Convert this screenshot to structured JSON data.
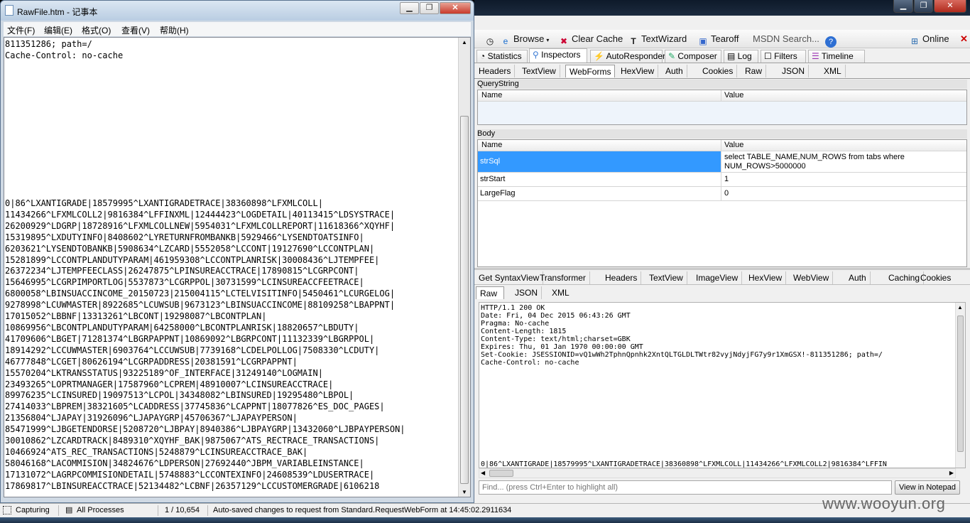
{
  "notepad": {
    "title": "RawFile.htm - 记事本",
    "menu": [
      "文件(F)",
      "编辑(E)",
      "格式(O)",
      "查看(V)",
      "帮助(H)"
    ],
    "content_top": "811351286; path=/\nCache-Control: no-cache",
    "content_body": "0|86^LXANTIGRADE|18579995^LXANTIGRADETRACE|38360898^LFXMLCOLL|\n11434266^LFXMLCOLL2|9816384^LFFINXML|12444423^LOGDETAIL|40113415^LDSYSTRACE|\n26200929^LDGRP|18728916^LFXMLCOLLNEW|5954031^LFXMLCOLLREPORT|11618366^XQYHF|\n15319895^LXDUTYINFO|8408602^LYRETURNFROMBANKB|5929466^LYSENDTOATSINFO|\n6203621^LYSENDTOBANKB|5908634^LZCARD|5552058^LCCONT|19127690^LCCONTPLAN|\n15281899^LCCONTPLANDUTYPARAM|461959308^LCCONTPLANRISK|30008436^LJTEMPFEE|\n26372234^LJTEMPFEECLASS|26247875^LPINSUREACCTRACE|17890815^LCGRPCONT|\n15646995^LCGRPIMPORTLOG|5537873^LCGRPPOL|30731599^LCINSUREACCFEETRACE|\n6800058^LBINSUACCINCOME_20150723|215004115^LCTELVISITINFO|5450461^LCURGELOG|\n9278998^LCUWMASTER|8922685^LCUWSUB|9673123^LBINSUACCINCOME|88109258^LBAPPNT|\n17015052^LBBNF|13313261^LBCONT|19298087^LBCONTPLAN|\n10869956^LBCONTPLANDUTYPARAM|64258000^LBCONTPLANRISK|18820657^LBDUTY|\n41709606^LBGET|71281374^LBGRPAPPNT|10869092^LBGRPCONT|11132339^LBGRPPOL|\n18914292^LCCUWMASTER|6903764^LCCUWSUB|7739168^LCDELPOLLOG|7508330^LCDUTY|\n46777848^LCGET|80626194^LCGRPADDRESS|20381591^LCGRPAPPNT|\n15570204^LKTRANSSTATUS|93225189^OF_INTERFACE|31249140^LOGMAIN|\n23493265^LOPRTMANAGER|17587960^LCPREM|48910007^LCINSUREACCTRACE|\n89976235^LCINSURED|19097513^LCPOL|34348082^LBINSURED|19295480^LBPOL|\n27414033^LBPREM|38321605^LCADDRESS|37745836^LCAPPNT|18077826^ES_DOC_PAGES|\n21356804^LJAPAY|31926096^LJAPAYGRP|45706367^LJAPAYPERSON|\n85471999^LJBGETENDORSE|5208720^LJBPAY|8940386^LJBPAYGRP|13432060^LJBPAYPERSON|\n30010862^LZCARDTRACK|8489310^XQYHF_BAK|9875067^ATS_RECTRACE_TRANSACTIONS|\n10466924^ATS_REC_TRANSACTIONS|5248879^LCINSUREACCTRACE_BAK|\n58046168^LACOMMISION|34824676^LDPERSON|27692440^JBPM_VARIABLEINSTANCE|\n17131072^LAGRPCOMMISIONDETAIL|5748883^LCCONTEXINFO|24608539^LDUSERTRACE|\n17869817^LBINSUREACCTRACE|52134482^LCBNF|26357129^LCCUSTOMERGRADE|6106218"
  },
  "fiddler": {
    "toolbar": {
      "browse": "Browse",
      "clear_cache": "Clear Cache",
      "textwizard": "TextWizard",
      "tearoff": "Tearoff",
      "search_placeholder": "MSDN Search...",
      "online": "Online"
    },
    "main_tabs": [
      "Statistics",
      "Inspectors",
      "AutoResponder",
      "Composer",
      "Log",
      "Filters",
      "Timeline"
    ],
    "request_tabs": [
      "Headers",
      "TextView",
      "WebForms",
      "HexView",
      "Auth",
      "Cookies",
      "Raw",
      "JSON",
      "XML"
    ],
    "querystring": {
      "section": "QueryString",
      "col_name": "Name",
      "col_value": "Value"
    },
    "body": {
      "section": "Body",
      "col_name": "Name",
      "col_value": "Value",
      "rows": [
        {
          "name": "strSql",
          "value": "select TABLE_NAME,NUM_ROWS from tabs where\nNUM_ROWS>5000000"
        },
        {
          "name": "strStart",
          "value": "1"
        },
        {
          "name": "LargeFlag",
          "value": "0"
        }
      ]
    },
    "response_tabs": [
      "Get SyntaxView",
      "Transformer",
      "Headers",
      "TextView",
      "ImageView",
      "HexView",
      "WebView",
      "Auth",
      "Caching",
      "Cookies"
    ],
    "response_subtabs": [
      "Raw",
      "JSON",
      "XML"
    ],
    "response_text": "HTTP/1.1 200 OK\nDate: Fri, 04 Dec 2015 06:43:26 GMT\nPragma: No-cache\nContent-Length: 1815\nContent-Type: text/html;charset=GBK\nExpires: Thu, 01 Jan 1970 00:00:00 GMT\nSet-Cookie: JSESSIONID=vQ1wWh2TphnQpnhk2XntQLTGLDLTWtr82vyjNdyjFG7y9r1XmGSX!-811351286; path=/\nCache-Control: no-cache",
    "response_tail": "0|86^LXANTIGRADE|18579995^LXANTIGRADETRACE|38360898^LFXMLCOLL|11434266^LFXMLCOLL2|9816384^LFFIN",
    "find_placeholder": "Find... (press Ctrl+Enter to highlight all)",
    "view_in_notepad": "View in Notepad"
  },
  "statusbar": {
    "capturing": "Capturing",
    "processes": "All Processes",
    "count": "1 / 10,654",
    "message": "Auto-saved changes to request from Standard.RequestWebForm at 14:45:02.2911634",
    "watermark": "www.wooyun.org"
  },
  "colors": {
    "selection": "#3399ff",
    "window_bg": "#f0f0f0",
    "close_red": "#c8392b"
  }
}
